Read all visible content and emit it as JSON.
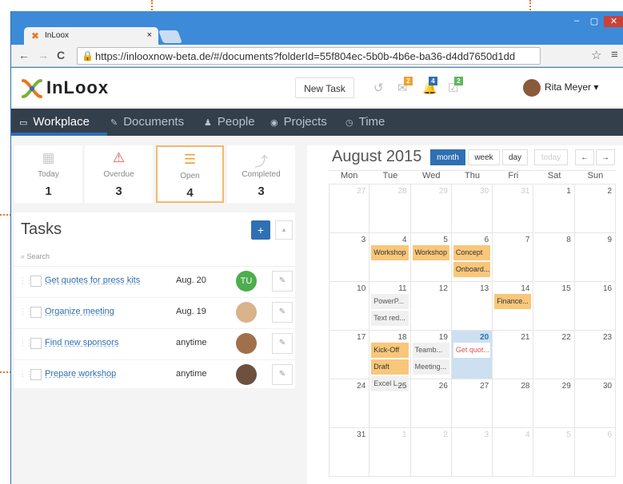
{
  "browser": {
    "tab_title": "InLoox",
    "tab_close": "×",
    "url": "https://inlooxnow-beta.de/#/documents?folderId=55f804ec-5b0b-4b6e-ba36-d4dd7650d1dd",
    "window_controls": [
      "–",
      "▢",
      "✕"
    ],
    "nav_icons": [
      "←",
      "→",
      "C"
    ]
  },
  "app": {
    "brand": "InLoox",
    "new_task": "New Task",
    "badges": [
      "2",
      "4",
      "2"
    ],
    "user": "Rita Meyer ▾",
    "nav": [
      {
        "label": "Workplace",
        "icon": "▭"
      },
      {
        "label": "Documents",
        "icon": "✎"
      },
      {
        "label": "People",
        "icon": "♟"
      },
      {
        "label": "Projects",
        "icon": "◉"
      },
      {
        "label": "Time",
        "icon": "◷"
      }
    ]
  },
  "stats": [
    {
      "label": "Today",
      "count": "1",
      "icon": "▦"
    },
    {
      "label": "Overdue",
      "count": "3",
      "icon": "⚠"
    },
    {
      "label": "Open",
      "count": "4",
      "icon": "☰"
    },
    {
      "label": "Completed",
      "count": "3",
      "icon": "⤴"
    }
  ],
  "tasks": {
    "title": "Tasks",
    "add": "+",
    "collapse": "▴",
    "search": "Search",
    "items": [
      {
        "name": "Get quotes for press kits",
        "date": "Aug. 20",
        "initials": "TU"
      },
      {
        "name": "Organize meeting",
        "date": "Aug. 19",
        "initials": ""
      },
      {
        "name": "Find new sponsors",
        "date": "anytime",
        "initials": ""
      },
      {
        "name": "Prepare workshop",
        "date": "anytime",
        "initials": ""
      }
    ]
  },
  "calendar": {
    "title": "August 2015",
    "views": [
      "month",
      "week",
      "day"
    ],
    "today": "today",
    "prev": "←",
    "next": "→",
    "weekdays": [
      "Mon",
      "Tue",
      "Wed",
      "Thu",
      "Fri",
      "Sat",
      "Sun"
    ],
    "weeks": [
      [
        "27",
        "28",
        "29",
        "30",
        "31",
        "1",
        "2"
      ],
      [
        "3",
        "4",
        "5",
        "6",
        "7",
        "8",
        "9"
      ],
      [
        "10",
        "11",
        "12",
        "13",
        "14",
        "15",
        "16"
      ],
      [
        "17",
        "18",
        "19",
        "20",
        "21",
        "22",
        "23"
      ],
      [
        "24",
        "25",
        "26",
        "27",
        "28",
        "29",
        "30"
      ],
      [
        "31",
        "1",
        "2",
        "3",
        "4",
        "5",
        "6"
      ]
    ],
    "events": [
      {
        "week": 1,
        "day": 1,
        "slot": 0,
        "label": "Workshop",
        "style": "o"
      },
      {
        "week": 1,
        "day": 2,
        "slot": 0,
        "label": "Workshop",
        "style": "o"
      },
      {
        "week": 1,
        "day": 3,
        "slot": 0,
        "label": "Concept",
        "style": "o"
      },
      {
        "week": 1,
        "day": 3,
        "slot": 1,
        "label": "Onboard...",
        "style": "o"
      },
      {
        "week": 2,
        "day": 1,
        "slot": 0,
        "label": "PowerP...",
        "style": "g"
      },
      {
        "week": 2,
        "day": 1,
        "slot": 1,
        "label": "Text red...",
        "style": "g"
      },
      {
        "week": 2,
        "day": 4,
        "slot": 0,
        "label": "Finance...",
        "style": "o"
      },
      {
        "week": 3,
        "day": 1,
        "slot": 0,
        "label": "Kick-Off",
        "style": "o"
      },
      {
        "week": 3,
        "day": 1,
        "slot": 1,
        "label": "Draft",
        "style": "o"
      },
      {
        "week": 3,
        "day": 1,
        "slot": 2,
        "label": "Excel L...",
        "style": "g"
      },
      {
        "week": 3,
        "day": 2,
        "slot": 0,
        "label": "Teamb...",
        "style": "g"
      },
      {
        "week": 3,
        "day": 2,
        "slot": 1,
        "label": "Meeting...",
        "style": "g"
      },
      {
        "week": 3,
        "day": 3,
        "slot": 0,
        "label": "Get quot...",
        "style": "r"
      }
    ]
  }
}
